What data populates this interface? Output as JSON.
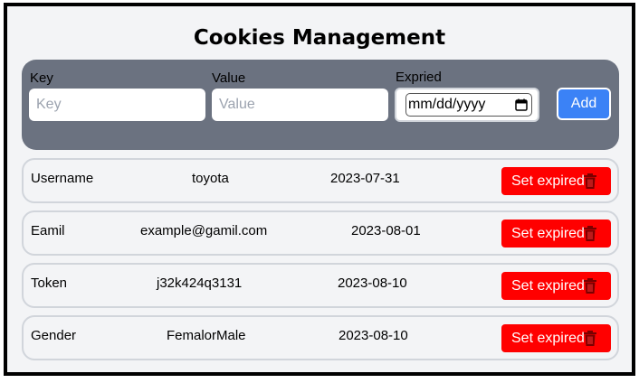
{
  "title": "Cookies Management",
  "form": {
    "key_label": "Key",
    "key_placeholder": "Key",
    "value_label": "Value",
    "value_placeholder": "Value",
    "expired_label": "Expried",
    "date_placeholder": "mm/dd/yyyy",
    "add_label": "Add"
  },
  "rows": [
    {
      "key": "Username",
      "value": "toyota",
      "date": "2023-07-31",
      "action": "Set expired"
    },
    {
      "key": "Eamil",
      "value": "example@gamil.com",
      "date": "2023-08-01",
      "action": "Set expired"
    },
    {
      "key": "Token",
      "value": "j32k424q3131",
      "date": "2023-08-10",
      "action": "Set expired"
    },
    {
      "key": "Gender",
      "value": "FemalorMale",
      "date": "2023-08-10",
      "action": "Set expired"
    }
  ],
  "colors": {
    "panel": "#6b7280",
    "add_button": "#3b82f6",
    "expire_button": "#ff0000",
    "background": "#f3f4f6"
  },
  "icons": {
    "row_action": "trash-icon",
    "date": "calendar-icon"
  }
}
